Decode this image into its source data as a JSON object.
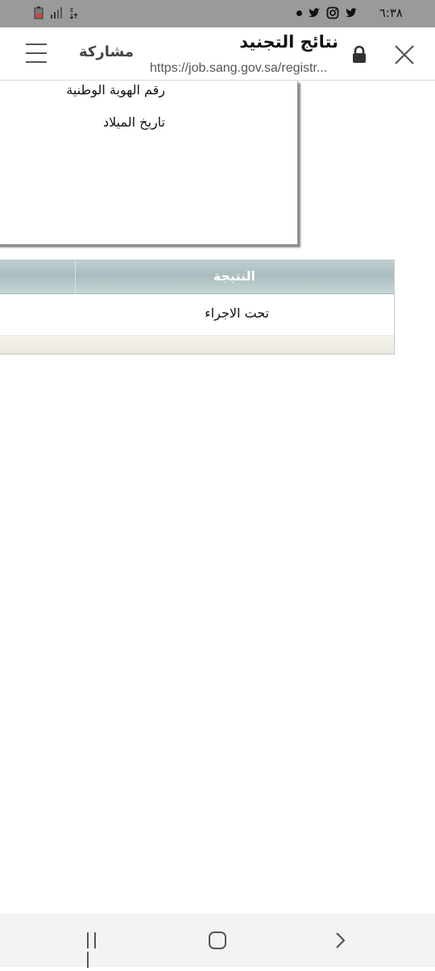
{
  "status_bar": {
    "time": "٦:٣٨",
    "icons": [
      "twitter-icon",
      "instagram-icon",
      "twitter-icon",
      "notification-dot"
    ],
    "left_icons": [
      "battery-icon",
      "signal-icon",
      "data-arrows-icon"
    ]
  },
  "browser": {
    "title": "نتائج التجنيد",
    "url": "https://job.sang.gov.sa/registr...",
    "share_label": "مشاركة"
  },
  "info_box": {
    "national_id_label": "رقم الهوية الوطنية",
    "birth_date_label": "تاريخ الميلاد"
  },
  "result_table": {
    "header": "النتيجة",
    "value": "تحت الاجراء"
  },
  "colors": {
    "status_bar_bg": "#9a9a9a",
    "table_header_bg": "#b3c5c7",
    "table_footer_bg": "#ece9e0"
  }
}
